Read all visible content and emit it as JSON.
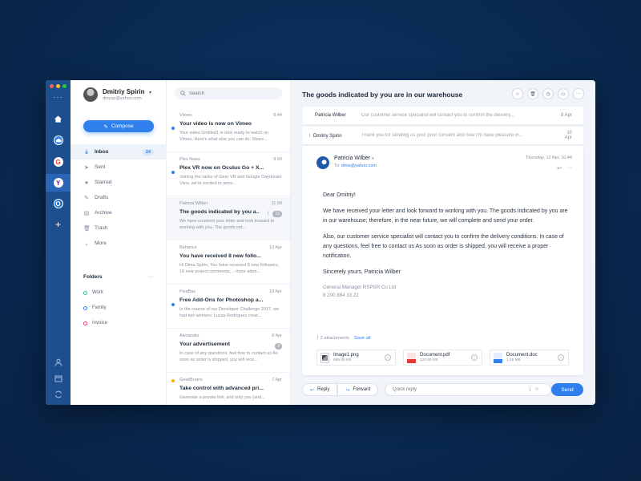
{
  "rail": {
    "more": "···",
    "items": [
      {
        "name": "home-icon",
        "glyph": "⌂"
      },
      {
        "name": "cloud-icon",
        "glyph": "☁"
      },
      {
        "name": "google-icon",
        "glyph": "G"
      },
      {
        "name": "yahoo-icon",
        "glyph": "Y"
      },
      {
        "name": "outlook-icon",
        "glyph": "O"
      },
      {
        "name": "add-account-icon",
        "glyph": "+"
      }
    ],
    "colors": {
      "red": "#ff5f57",
      "yellow": "#ffbd2e",
      "green": "#28c840"
    }
  },
  "profile": {
    "name": "Dmitriy Spirin",
    "email": "dmysp@yahoo.com"
  },
  "sidebar": {
    "compose_label": "Compose",
    "nav": [
      {
        "label": "Inbox",
        "icon": "⤓",
        "badge": "24"
      },
      {
        "label": "Sent",
        "icon": "➤"
      },
      {
        "label": "Starred",
        "icon": "★"
      },
      {
        "label": "Drafts",
        "icon": "✎"
      },
      {
        "label": "Archive",
        "icon": "▤"
      },
      {
        "label": "Trash",
        "icon": "🗑"
      },
      {
        "label": "More",
        "icon": "⌄"
      }
    ],
    "folders_title": "Folders",
    "folders": [
      {
        "label": "Work",
        "color": "#2fbfa0"
      },
      {
        "label": "Family",
        "color": "#2f80ed"
      },
      {
        "label": "Invoice",
        "color": "#eb3b6b"
      }
    ]
  },
  "search": {
    "placeholder": "Search"
  },
  "messages": [
    {
      "from": "Vimeo",
      "date": "8:44",
      "subject": "Your video is now on Vimeo",
      "preview": "Your video Untitled1 is now ready to watch on Vimeo. Here's what else you can do: Share...",
      "unread_color": "#2f80ed"
    },
    {
      "from": "Plex News",
      "date": "9:00",
      "subject": "Plex VR now on Oculus Go + X...",
      "preview": "Joining the ranks of Gear VR and Google Daydream View, we're excited to anno...",
      "unread_color": "#2f80ed"
    },
    {
      "from": "Patricia Wilber",
      "date": "11:00",
      "subject": "The goods indicated by you a...",
      "preview": "We have received your letter and look forward to working with you. The goods ind...",
      "count": "16"
    },
    {
      "from": "Behance",
      "date": "10 Apr",
      "subject": "You have received 8 new follo...",
      "preview": "Hi Dima Spirin, You have received 8 new followers, 16 new project comments,... more atten..."
    },
    {
      "from": "PixaBay",
      "date": "10 Apr",
      "subject": "Free Add-Ons for Photoshop a...",
      "preview": "In the course of our Developer Challenge 2017, we had two winners: Lucas Rodrigues creat...",
      "unread_color": "#2f80ed"
    },
    {
      "from": "Alexander",
      "date": "8 Apr",
      "subject": "Your advertisement",
      "preview": "In case of any questions, feel free to contact us As soon as order is shipped, you will rece...",
      "count": "3"
    },
    {
      "from": "GeekBrains",
      "date": "7 Apr",
      "subject": "Take control with advanced pri...",
      "preview": "Generate a private link, and only you (and...",
      "unread_color": "#f5b700"
    }
  ],
  "pane": {
    "title": "The goods indicated by you are in our warehouse",
    "thread": [
      {
        "from": "Patricia Wilber",
        "preview": "Our customer service specialist will contact you to confirm the delivery...",
        "date": "8 Apr"
      },
      {
        "from": "Dmitriy Spirin",
        "preview": "Thank you for sending us your prior consent and now I'm have pleasure in...",
        "date": "10 Apr"
      }
    ],
    "message": {
      "sender": "Patricia Wilber",
      "to_label": "To:",
      "to": "dmis@yahoo.com",
      "date": "Thursday, 12 Apr, 10:44",
      "greeting": "Dear Dmitriy!",
      "p1": "We have received your letter and look forward to working with you. The goods indicated by you are in our warehouse; therefore, in the near future, we will complete and send your order.",
      "p2": "Also, our customer service specialist will contact you to confirm the delivery conditions. In case of any questions, feel free to contact us As soon as order is shipped, you will receive a proper notification.",
      "closing": "Sincerely yours, Patricia Wilber",
      "sig_title": "General Manager RSPSR Co Ltd",
      "sig_phone": "8 200 884 33 22"
    },
    "attachments_label": "2 attachments",
    "save_all": "Save all",
    "attachments": [
      {
        "name": "Image1.png",
        "size": "665.00 KB",
        "color": "#6b7280"
      },
      {
        "name": "Document.pdf",
        "size": "120.00 KB",
        "color": "#e53935"
      },
      {
        "name": "Document.doc",
        "size": "1.55 MB",
        "color": "#2f80ed"
      }
    ],
    "reply_label": "Reply",
    "forward_label": "Forward",
    "quick_placeholder": "Quick reply",
    "send_label": "Send"
  }
}
